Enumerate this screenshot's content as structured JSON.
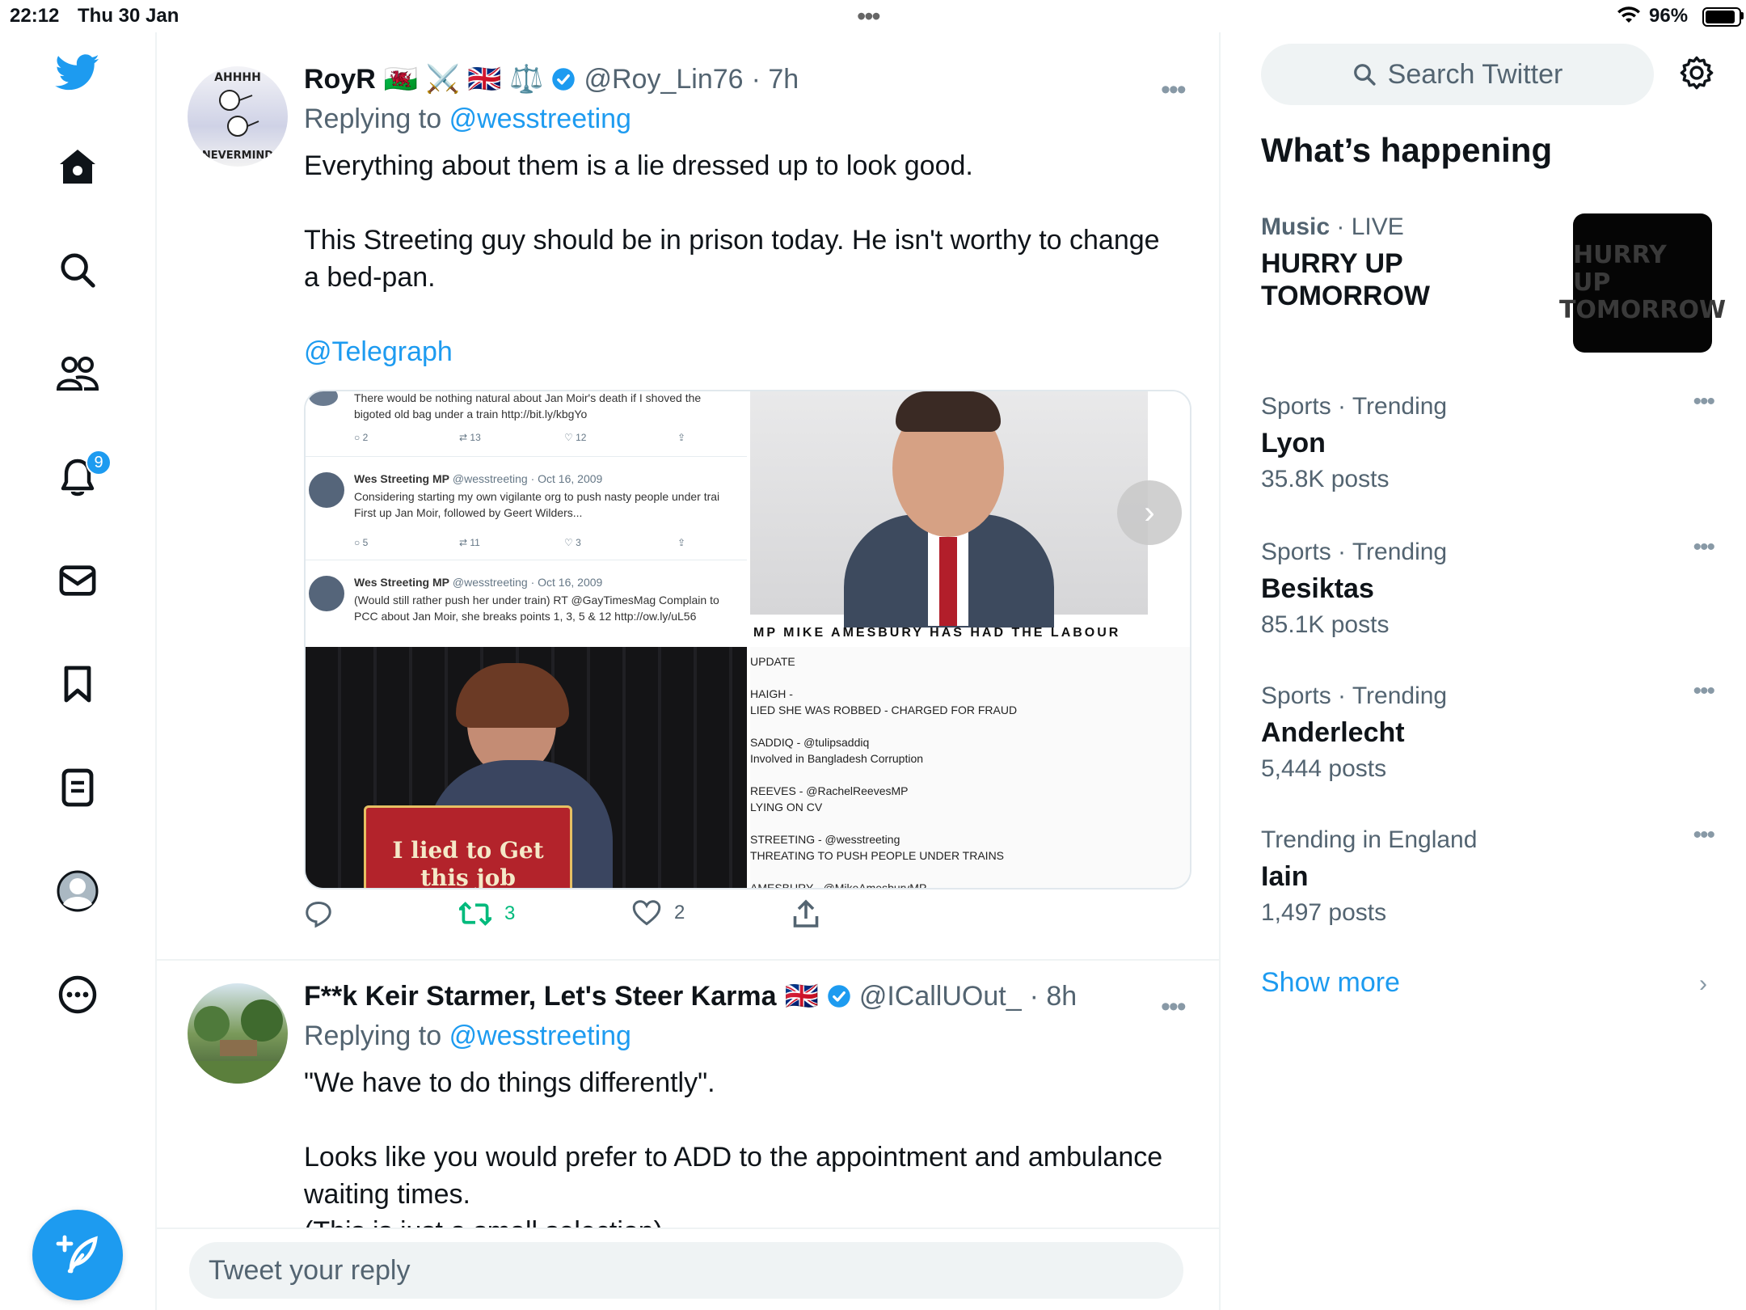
{
  "status_bar": {
    "time": "22:12",
    "date": "Thu 30 Jan",
    "dots": "•••",
    "battery": "96%"
  },
  "nav": {
    "notifications_badge": "9"
  },
  "tweets": [
    {
      "name": "RoyR",
      "flags": "🏴󠁧󠁢󠁷󠁬󠁳󠁿 ⚔️ 🇬🇧 ⚖️",
      "handle": "@Roy_Lin76",
      "time": "· 7h",
      "replying_prefix": "Replying to",
      "replying_to": "@wesstreeting",
      "paragraphs": [
        "Everything about them is a lie dressed up to look good.",
        "This Streeting guy should be in prison today. He isn't worthy to change a bed-pan."
      ],
      "mention": "@Telegraph",
      "avatar_text": {
        "top": "AHHHH",
        "bottom": "NEVERMIND"
      },
      "media": {
        "q1": {
          "line1": "There would be nothing natural about Jan Moir's death if I shoved the",
          "line2": "bigoted old bag under a train http://bit.ly/kbgYo",
          "c1": "2",
          "c2": "13",
          "c3": "12",
          "t2_name": "Wes Streeting MP",
          "t2_handle": "@wesstreeting · Oct 16, 2009",
          "t2_line1": "Considering starting my own vigilante org to push nasty people under trai",
          "t2_line2": "First up Jan Moir, followed by Geert Wilders...",
          "t2_c1": "5",
          "t2_c2": "11",
          "t2_c3": "3",
          "t3_name": "Wes Streeting MP",
          "t3_handle": "@wesstreeting · Oct 16, 2009",
          "t3_line1": "(Would still rather push her under train) RT @GayTimesMag Complain to",
          "t3_line2": "PCC about Jan Moir, she breaks points 1, 3, 5 & 12 http://ow.ly/uL56"
        },
        "q2": {
          "caption": "MP MIKE AMESBURY HAS HAD THE LABOUR"
        },
        "q3": {
          "box_text": "I lied to Get",
          "box_text2": "this job"
        },
        "q4": {
          "lines": [
            "UPDATE",
            "HAIGH -",
            "LIED SHE WAS ROBBED - CHARGED FOR FRAUD",
            "SADDIQ - @tulipsaddiq",
            "Involved in Bangladesh Corruption",
            "REEVES - @RachelReevesMP",
            "LYING ON CV",
            "STREETING - @wesstreeting",
            "THREATING TO PUSH PEOPLE UNDER TRAINS",
            "AMESBURY - @MikeAmesburyMP"
          ]
        }
      },
      "retweets": "3",
      "likes": "2"
    },
    {
      "name": "F**k Keir Starmer, Let's Steer Karma",
      "flags": "🇬🇧",
      "handle": "@ICallUOut_",
      "time": "· 8h",
      "replying_prefix": "Replying to",
      "replying_to": "@wesstreeting",
      "paragraphs": [
        "\"We have to do things differently\".",
        "Looks like you would prefer to ADD to the appointment and ambulance waiting times.",
        "(This is just a small selection)"
      ]
    }
  ],
  "reply_placeholder": "Tweet your reply",
  "sidebar": {
    "search_placeholder": "Search Twitter",
    "title": "What’s happening",
    "live": {
      "category": "Music",
      "status": "· LIVE",
      "name": "HURRY UP TOMORROW",
      "thumb_line1": "HURRY UP",
      "thumb_line2": "TOMORROW"
    },
    "trends": [
      {
        "category": "Sports · Trending",
        "name": "Lyon",
        "count": "35.8K posts"
      },
      {
        "category": "Sports · Trending",
        "name": "Besiktas",
        "count": "85.1K posts"
      },
      {
        "category": "Sports · Trending",
        "name": "Anderlecht",
        "count": "5,444 posts"
      },
      {
        "category": "Trending in England",
        "name": "Iain",
        "count": "1,497 posts"
      }
    ],
    "show_more": "Show more"
  },
  "colors": {
    "accent": "#1d9bf0",
    "retweet_green": "#00ba7c",
    "text": "#0f1419",
    "muted": "#536471"
  }
}
